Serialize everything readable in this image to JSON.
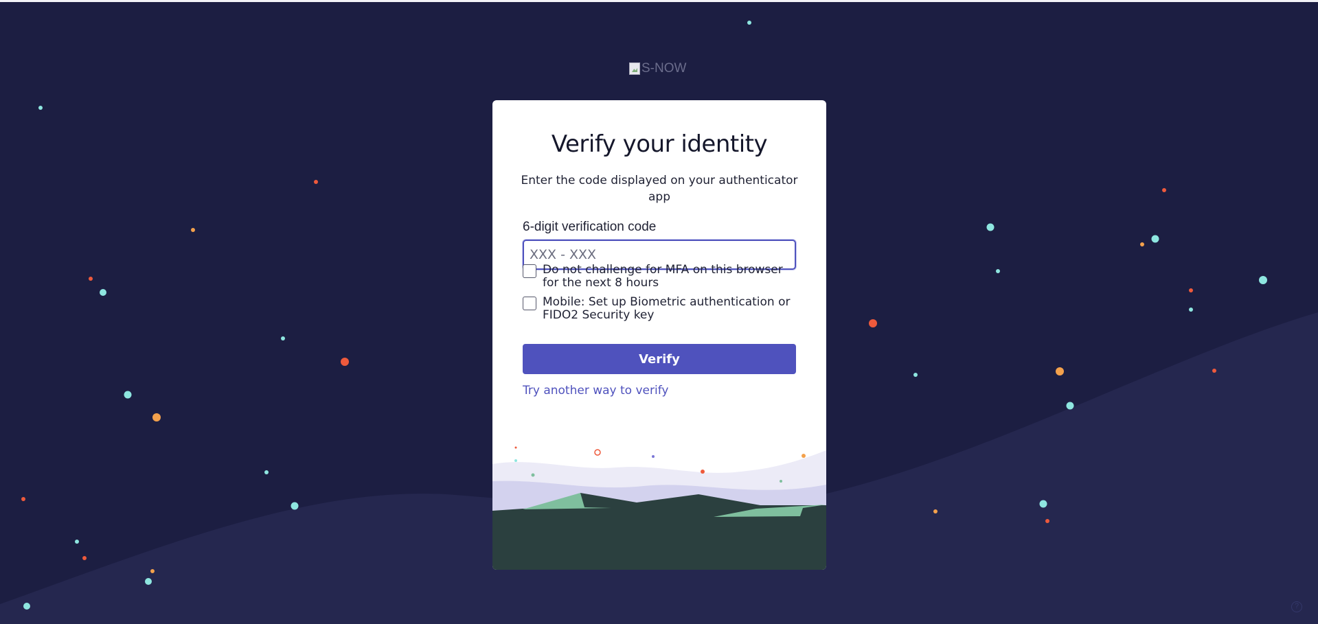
{
  "logo": {
    "alt_text": "S-NOW"
  },
  "card": {
    "title": "Verify your identity",
    "subtitle": "Enter the code displayed on your authenticator app",
    "code_field": {
      "label": "6-digit verification code",
      "placeholder": "XXX - XXX",
      "value": ""
    },
    "checkboxes": [
      {
        "label": "Do not challenge for MFA on this browser for the next 8 hours",
        "checked": false
      },
      {
        "label": "Mobile: Set up Biometric authentication or FIDO2 Security key",
        "checked": false
      }
    ],
    "verify_label": "Verify",
    "alt_link": "Try another way to verify"
  },
  "colors": {
    "background": "#1c1e42",
    "accent": "#4f52bd",
    "card": "#ffffff",
    "dot_teal": "#8ee6e0",
    "dot_orange": "#f3a14c",
    "dot_red": "#ee5a3c"
  },
  "icons": {
    "help": "help-circle-icon",
    "logo": "broken-image-icon"
  }
}
